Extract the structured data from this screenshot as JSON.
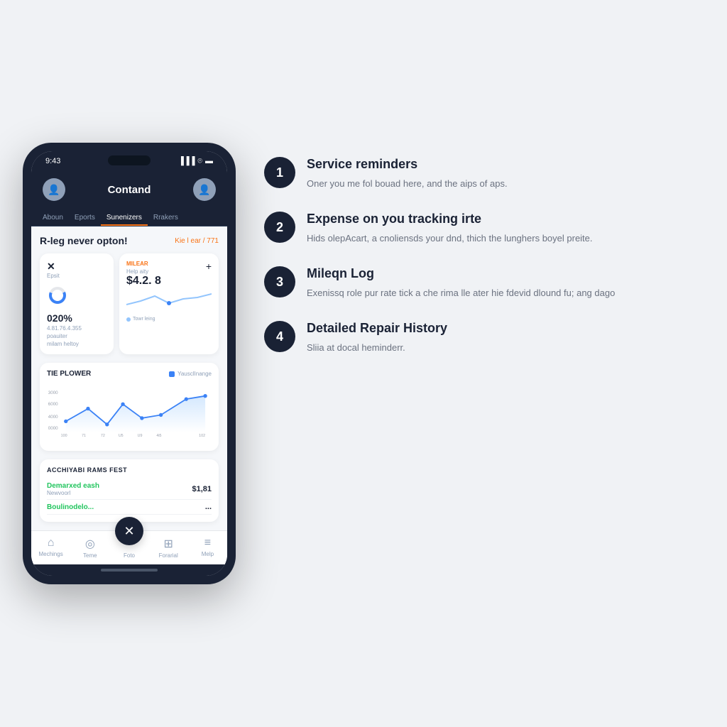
{
  "phone": {
    "status_time": "9:43",
    "header_title": "Contand",
    "nav_tabs": [
      "Aboun",
      "Eports",
      "Sunenizers",
      "Rrakers"
    ],
    "active_tab": 2,
    "section_title": "R-leg never opton!",
    "section_link": "Kie l ear / 771",
    "card1": {
      "icon": "✕",
      "label": "Epsit",
      "value": "020%",
      "sub1": "4.81.76.4.355",
      "sub2": "poauiter",
      "sub3": "milam heltoy"
    },
    "card2": {
      "label": "MILEAR",
      "sublabel": "Help aity",
      "value": "$4.2. 8",
      "legend": "Towr leing"
    },
    "chart": {
      "title": "TIE PLOWER",
      "legend": "YausclInange",
      "y_labels": [
        "3000",
        "6000",
        "4000",
        "0000"
      ],
      "x_labels": [
        "100",
        "71",
        "72",
        "U5",
        "U9",
        "4i5",
        "102"
      ]
    },
    "repairs": {
      "title": "ACCHIYABI RAMS FEST",
      "items": [
        {
          "name": "Demarxed eash",
          "sub": "Newvoorl",
          "amount": "$1,81"
        },
        {
          "name": "Boulinodelo...",
          "sub": "",
          "amount": "..."
        }
      ]
    },
    "bottom_nav": [
      {
        "label": "Mechings",
        "icon": "⌂"
      },
      {
        "label": "Teme",
        "icon": "◎"
      },
      {
        "label": "Foto",
        "icon": "✕"
      },
      {
        "label": "Forarial",
        "icon": "⊞"
      },
      {
        "label": "Melp",
        "icon": "≡"
      }
    ]
  },
  "features": [
    {
      "number": "1",
      "title": "Service reminders",
      "desc": "Oner you me fol bouad here, and the aips of aps."
    },
    {
      "number": "2",
      "title": "Expense on you tracking irte",
      "desc": "Hids olepAcart, a cnoliensds your dnd, thich the lunghers boyel preite."
    },
    {
      "number": "3",
      "title": "Mileqn Log",
      "desc": "Exenissq role pur rate tick a che rima lle ater hie fdevid dlound fu; ang dago"
    },
    {
      "number": "4",
      "title": "Detailed Repair History",
      "desc": "Sliia at docal heminderr."
    }
  ]
}
